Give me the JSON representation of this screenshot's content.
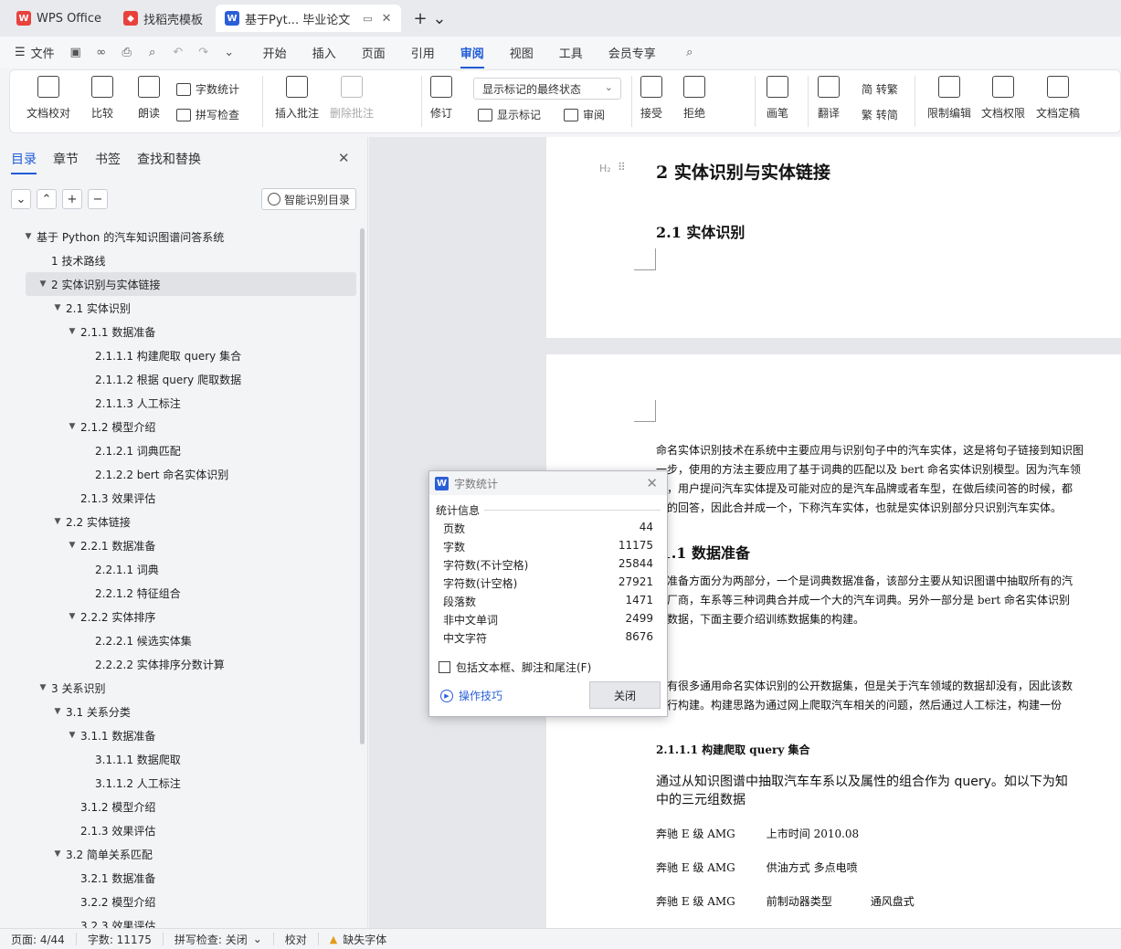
{
  "tabs": [
    {
      "label": "WPS Office"
    },
    {
      "label": "找稻壳模板"
    },
    {
      "label": "基于Pyt... 毕业论文"
    }
  ],
  "menu": {
    "file": "文件",
    "tabs": [
      "开始",
      "插入",
      "页面",
      "引用",
      "审阅",
      "视图",
      "工具",
      "会员专享"
    ],
    "active_tab": "审阅"
  },
  "ribbon": {
    "doc_check": "文档校对",
    "compare": "比较",
    "read_aloud": "朗读",
    "word_count": "字数统计",
    "spell_check": "拼写检查",
    "insert_comment": "插入批注",
    "delete_comment": "删除批注",
    "revise": "修订",
    "markup_state": "显示标记的最终状态",
    "show_markup": "显示标记",
    "review": "审阅",
    "accept": "接受",
    "reject": "拒绝",
    "pen": "画笔",
    "translate": "翻译",
    "to_traditional": "简 转繁",
    "to_simplified": "繁 转简",
    "restrict_edit": "限制编辑",
    "doc_permission": "文档权限",
    "finalize": "文档定稿"
  },
  "panel": {
    "tabs": [
      "目录",
      "章节",
      "书签",
      "查找和替换"
    ],
    "smart_btn": "智能识别目录",
    "toc": [
      {
        "level": 0,
        "text": "基于 Python 的汽车知识图谱问答系统",
        "tri": true
      },
      {
        "level": 1,
        "text": "1  技术路线",
        "tri": false
      },
      {
        "level": 1,
        "text": "2  实体识别与实体链接",
        "tri": true,
        "selected": true
      },
      {
        "level": 2,
        "text": "2.1  实体识别",
        "tri": true
      },
      {
        "level": 3,
        "text": "2.1.1  数据准备",
        "tri": true
      },
      {
        "level": 4,
        "text": "2.1.1.1  构建爬取  query  集合",
        "tri": false
      },
      {
        "level": 4,
        "text": "2.1.1.2  根据  query  爬取数据",
        "tri": false
      },
      {
        "level": 4,
        "text": "2.1.1.3  人工标注",
        "tri": false
      },
      {
        "level": 3,
        "text": "2.1.2  模型介绍",
        "tri": true
      },
      {
        "level": 4,
        "text": "2.1.2.1  词典匹配",
        "tri": false
      },
      {
        "level": 4,
        "text": "2.1.2.2 bert  命名实体识别",
        "tri": false
      },
      {
        "level": 3,
        "text": "2.1.3  效果评估",
        "tri": false
      },
      {
        "level": 2,
        "text": "2.2  实体链接",
        "tri": true
      },
      {
        "level": 3,
        "text": "2.2.1  数据准备",
        "tri": true
      },
      {
        "level": 4,
        "text": "2.2.1.1  词典",
        "tri": false
      },
      {
        "level": 4,
        "text": "2.2.1.2  特征组合",
        "tri": false
      },
      {
        "level": 3,
        "text": "2.2.2  实体排序",
        "tri": true
      },
      {
        "level": 4,
        "text": "2.2.2.1  候选实体集",
        "tri": false
      },
      {
        "level": 4,
        "text": "2.2.2.2  实体排序分数计算",
        "tri": false
      },
      {
        "level": 1,
        "text": "3  关系识别",
        "tri": true
      },
      {
        "level": 2,
        "text": "3.1  关系分类",
        "tri": true
      },
      {
        "level": 3,
        "text": "3.1.1  数据准备",
        "tri": true
      },
      {
        "level": 4,
        "text": "3.1.1.1  数据爬取",
        "tri": false
      },
      {
        "level": 4,
        "text": "3.1.1.2  人工标注",
        "tri": false
      },
      {
        "level": 3,
        "text": "3.1.2  模型介绍",
        "tri": false
      },
      {
        "level": 3,
        "text": "2.1.3  效果评估",
        "tri": false
      },
      {
        "level": 2,
        "text": "3.2  简单关系匹配",
        "tri": true
      },
      {
        "level": 3,
        "text": "3.2.1  数据准备",
        "tri": false
      },
      {
        "level": 3,
        "text": "3.2.2  模型介绍",
        "tri": false
      },
      {
        "level": 3,
        "text": "3.2.3  效果评估",
        "tri": false
      }
    ]
  },
  "doc": {
    "heading_mark": "H₂",
    "h1": "2  实体识别与实体链接",
    "h2_1": "2.1  实体识别",
    "p1": [
      "命名实体识别技术在系统中主要应用与识别句子中的汽车实体，这是将句子链接到知识图",
      "一步，使用的方法主要应用了基于词典的匹配以及 bert 命名实体识别模型。因为汽车领",
      "性，用户提问汽车实体提及可能对应的是汽车品牌或者车型，在做后续问答的时候，都",
      "应的回答，因此合并成一个，下称汽车实体，也就是实体识别部分只识别汽车实体。"
    ],
    "h3_1": ".1.1  数据准备",
    "p2": [
      "据准备方面分为两部分，一个是词典数据准备，该部分主要从知识图谱中抽取所有的汽",
      "产厂商，车系等三种词典合并成一个大的汽车词典。另外一部分是 bert 命名实体识别",
      "练数据，下面主要介绍训练数据集的构建。"
    ],
    "p3": [
      "上有很多通用命名实体识别的公开数据集，但是关于汽车领域的数据却没有，因此该数",
      "自行构建。构建思路为通过网上爬取汽车相关的问题，然后通过人工标注，构建一份"
    ],
    "h4_1": "2.1.1.1  构建爬取   query   集合",
    "p4": [
      "通过从知识图谱中抽取汽车车系以及属性的组合作为   query。如以下为知",
      "中的三元组数据"
    ],
    "triples": [
      [
        "奔驰 E 级 AMG",
        "上市时间   2010.08",
        ""
      ],
      [
        "奔驰 E 级 AMG",
        "供油方式   多点电喷",
        ""
      ],
      [
        "奔驰 E 级 AMG",
        "前制动器类型",
        "通风盘式"
      ]
    ]
  },
  "dialog": {
    "title": "字数统计",
    "section": "统计信息",
    "stats": [
      {
        "label": "页数",
        "value": "44"
      },
      {
        "label": "字数",
        "value": "11175"
      },
      {
        "label": "字符数(不计空格)",
        "value": "25844"
      },
      {
        "label": "字符数(计空格)",
        "value": "27921"
      },
      {
        "label": "段落数",
        "value": "1471"
      },
      {
        "label": "非中文单词",
        "value": "2499"
      },
      {
        "label": "中文字符",
        "value": "8676"
      }
    ],
    "checkbox": "包括文本框、脚注和尾注(F)",
    "tips": "操作技巧",
    "close": "关闭"
  },
  "status": {
    "page": "页面: 4/44",
    "words": "字数: 11175",
    "spell": "拼写检查: 关闭",
    "proof": "校对",
    "missing_font": "缺失字体"
  },
  "colors": {
    "accent": "#1f5cd6",
    "wps_red": "#e8423d"
  }
}
